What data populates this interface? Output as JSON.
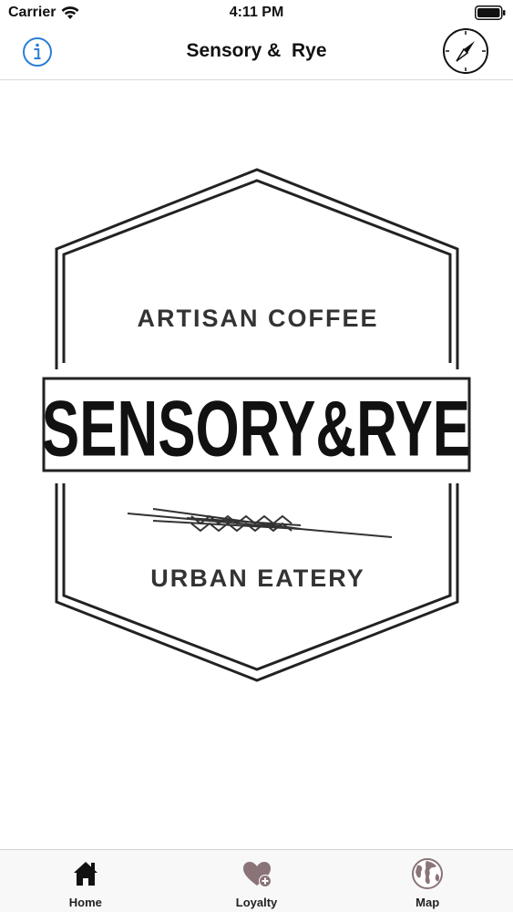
{
  "status_bar": {
    "carrier": "Carrier",
    "time": "4:11 PM"
  },
  "nav": {
    "title": "Sensory &  Rye",
    "info_icon": "info-icon",
    "compass_icon": "compass-icon",
    "accent_color": "#2a7fd4"
  },
  "logo": {
    "top_text": "ARTISAN COFFEE",
    "name_text": "SENSORY&RYE",
    "bottom_text": "URBAN EATERY"
  },
  "tabs": [
    {
      "label": "Home",
      "icon": "home-icon"
    },
    {
      "label": "Loyalty",
      "icon": "heart-plus-icon",
      "color": "#8a7477"
    },
    {
      "label": "Map",
      "icon": "globe-icon",
      "color": "#8a7477"
    }
  ]
}
